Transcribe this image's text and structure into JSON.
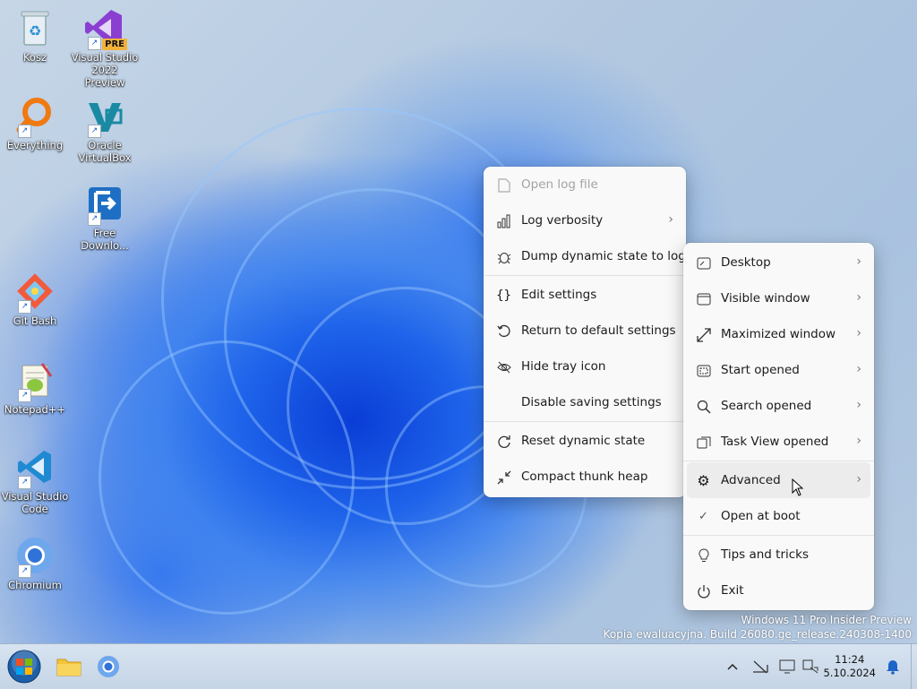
{
  "desktop_icons": [
    {
      "label": "Kosz"
    },
    {
      "label": "Visual Studio 2022 Preview",
      "badge": "PRE"
    },
    {
      "label": "Everything"
    },
    {
      "label": "Oracle VirtualBox"
    },
    {
      "label": "Free Downlo..."
    },
    {
      "label": "Git Bash"
    },
    {
      "label": "Notepad++"
    },
    {
      "label": "Visual Studio Code"
    },
    {
      "label": "Chromium"
    }
  ],
  "main_menu": [
    {
      "label": "Open log file",
      "icon": "document-icon",
      "disabled": true
    },
    {
      "label": "Log verbosity",
      "icon": "bar-chart-icon",
      "submenu": true
    },
    {
      "label": "Dump dynamic state to log",
      "icon": "bug-icon"
    },
    {
      "label": "Edit settings",
      "icon": "braces-icon"
    },
    {
      "label": "Return to default settings",
      "icon": "undo-icon"
    },
    {
      "label": "Hide tray icon",
      "icon": "eye-off-icon"
    },
    {
      "label": "Disable saving settings",
      "icon": ""
    },
    {
      "label": "Reset dynamic state",
      "icon": "refresh-icon"
    },
    {
      "label": "Compact thunk heap",
      "icon": "compress-icon"
    }
  ],
  "sub_menu": [
    {
      "label": "Desktop",
      "icon": "desktop-icon",
      "submenu": true
    },
    {
      "label": "Visible window",
      "icon": "window-icon",
      "submenu": true
    },
    {
      "label": "Maximized window",
      "icon": "maximize-icon",
      "submenu": true
    },
    {
      "label": "Start opened",
      "icon": "start-menu-icon",
      "submenu": true
    },
    {
      "label": "Search opened",
      "icon": "search-icon",
      "submenu": true
    },
    {
      "label": "Task View opened",
      "icon": "task-view-icon",
      "submenu": true
    },
    {
      "label": "Advanced",
      "icon": "gear-icon",
      "submenu": true,
      "hovered": true
    },
    {
      "label": "Open at boot",
      "icon": "checkmark-icon",
      "checked": true
    },
    {
      "label": "Tips and tricks",
      "icon": "lightbulb-icon"
    },
    {
      "label": "Exit",
      "icon": "power-icon"
    }
  ],
  "watermark": {
    "line1": "Windows 11 Pro Insider Preview",
    "line2": "Kopia ewaluacyjna. Build 26080.ge_release.240308-1400"
  },
  "clock": {
    "time": "11:24",
    "date": "5.10.2024"
  },
  "colors": {
    "accent": "#1e63ea",
    "menu_bg": "#f9f9f9",
    "taskbar_bg": "#d0dded"
  }
}
